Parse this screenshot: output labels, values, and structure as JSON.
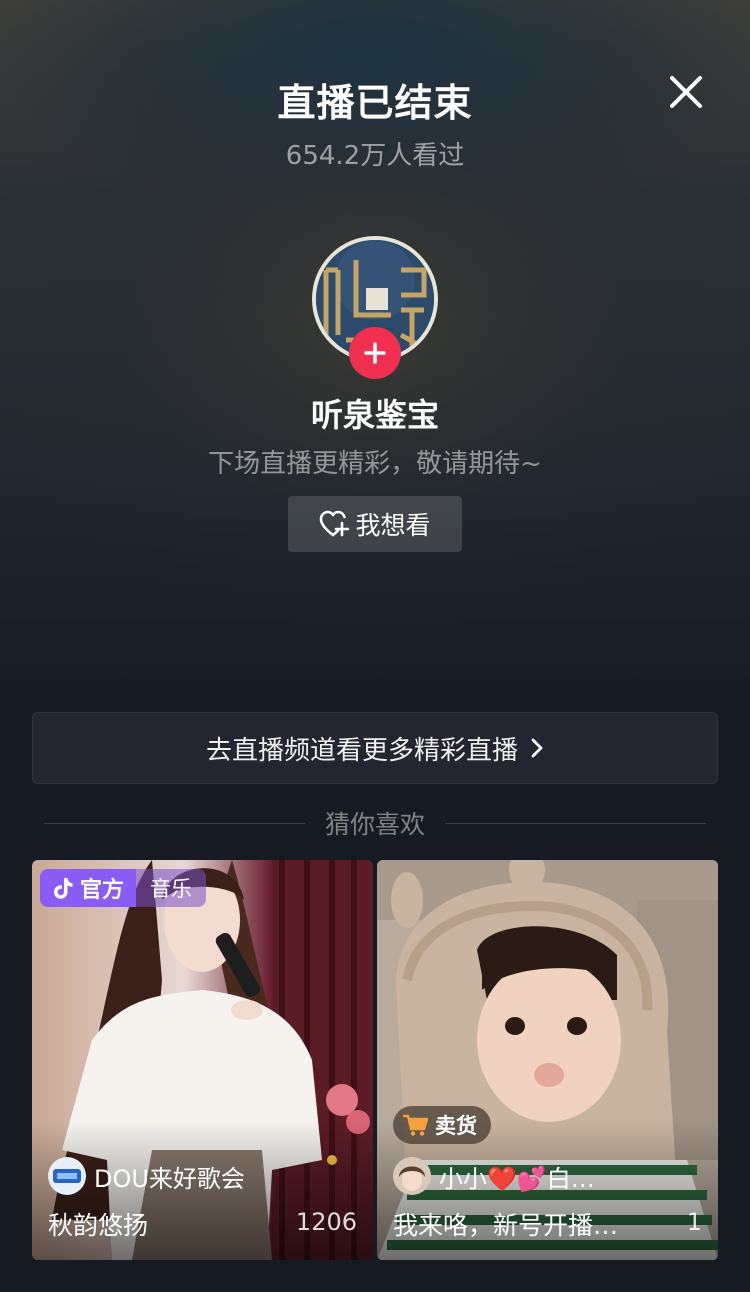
{
  "header": {
    "title": "直播已结束",
    "viewers": "654.2万人看过",
    "close_icon": "close-icon"
  },
  "host": {
    "name": "听泉鉴宝",
    "tagline": "下场直播更精彩，敬请期待~",
    "want_label": "我想看",
    "accent_color": "#f12f50"
  },
  "channel_link": {
    "label": "去直播频道看更多精彩直播"
  },
  "recommend": {
    "section_label": "猜你喜欢",
    "cards": [
      {
        "badge": "官方",
        "category": "音乐",
        "host_name": "DOU来好歌会",
        "title": "秋韵悠扬",
        "count": "1206"
      },
      {
        "badge": "卖货",
        "host_name": "小小❤️💕白…",
        "title": "我来咯，新号开播…",
        "count": "1"
      }
    ]
  }
}
